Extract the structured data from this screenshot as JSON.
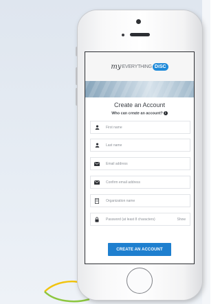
{
  "brand": {
    "logo_my": "my",
    "logo_everything": "EVERYTHING",
    "logo_disc": "DiSC"
  },
  "form": {
    "title": "Create an Account",
    "subtitle": "Who can create an account?",
    "info_glyph": "i",
    "fields": [
      {
        "icon": "person-icon",
        "placeholder": "First name"
      },
      {
        "icon": "person-icon",
        "placeholder": "Last name"
      },
      {
        "icon": "envelope-icon",
        "placeholder": "Email address"
      },
      {
        "icon": "envelope-icon",
        "placeholder": "Confirm email address"
      },
      {
        "icon": "building-icon",
        "placeholder": "Organization name"
      },
      {
        "icon": "lock-icon",
        "placeholder": "Password (at least 8 characters)",
        "aux": "Show"
      }
    ],
    "submit_label": "CREATE AN ACCOUNT"
  },
  "colors": {
    "accent": "#1e7fcf",
    "logo_badge": "#1f8ad9"
  }
}
